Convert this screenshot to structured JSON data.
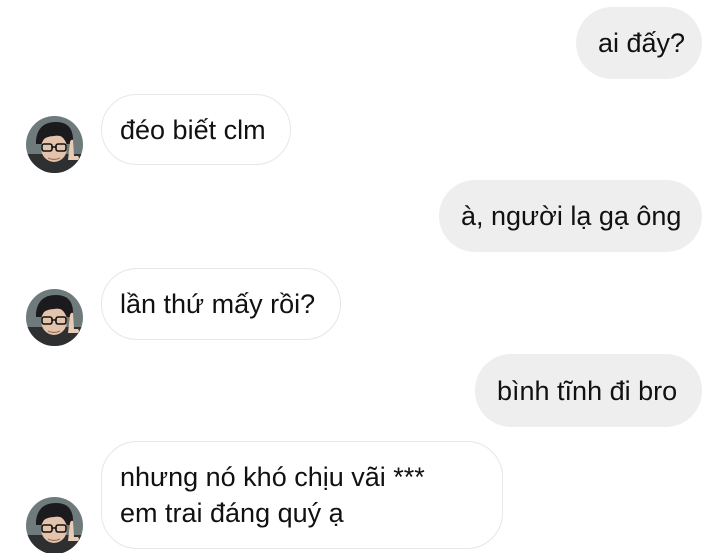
{
  "conversation": {
    "messages": [
      {
        "side": "outgoing",
        "text": "ai đấy?"
      },
      {
        "side": "incoming",
        "text": "đéo biết clm"
      },
      {
        "side": "outgoing",
        "text": "à, người lạ gạ ông"
      },
      {
        "side": "incoming",
        "text": "lần thứ mấy rồi?"
      },
      {
        "side": "outgoing",
        "text": "bình tĩnh đi bro"
      },
      {
        "side": "incoming",
        "lines": [
          "nhưng nó khó chịu vãi ***",
          "em trai đáng quý ạ"
        ]
      }
    ]
  },
  "colors": {
    "outgoing_bubble": "#eeeeee",
    "incoming_bubble": "#ffffff",
    "incoming_border": "#e6e6e6",
    "text": "#111111"
  },
  "icons": {
    "contact_avatar": "avatar-photo"
  }
}
